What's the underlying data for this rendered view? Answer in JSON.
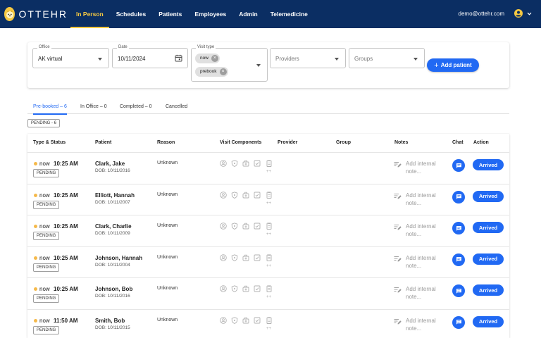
{
  "app": {
    "brand": "OTTEHR"
  },
  "nav": {
    "items": [
      {
        "label": "In Person",
        "active": true
      },
      {
        "label": "Schedules",
        "active": false
      },
      {
        "label": "Patients",
        "active": false
      },
      {
        "label": "Employees",
        "active": false
      },
      {
        "label": "Admin",
        "active": false
      },
      {
        "label": "Telemedicine",
        "active": false
      }
    ]
  },
  "user": {
    "email": "demo@ottehr.com",
    "icon": "account-circle-icon"
  },
  "filters": {
    "office": {
      "label": "Office",
      "value": "AK virtual"
    },
    "date": {
      "label": "Date",
      "value": "10/11/2024"
    },
    "visit_type": {
      "label": "Visit type",
      "chips": [
        "now",
        "prebook"
      ]
    },
    "providers": {
      "placeholder": "Providers"
    },
    "groups": {
      "placeholder": "Groups"
    },
    "add_patient_label": "Add patient"
  },
  "tabs": [
    {
      "label": "Pre-booked – 6",
      "active": true
    },
    {
      "label": "In Office – 0",
      "active": false
    },
    {
      "label": "Completed – 0",
      "active": false
    },
    {
      "label": "Cancelled",
      "active": false
    }
  ],
  "pending_group_label": "PENDING - 6",
  "table": {
    "columns": {
      "type_status": "Type & Status",
      "patient": "Patient",
      "reason": "Reason",
      "visit_components": "Visit Components",
      "provider": "Provider",
      "group": "Group",
      "notes": "Notes",
      "chat": "Chat",
      "action": "Action"
    },
    "visit_component_icons": [
      "user-check-icon",
      "shield-icon",
      "briefcase-icon",
      "checkbox-icon",
      "clipboard-icon"
    ],
    "visit_components_more": "++",
    "notes_placeholder": "Add internal note...",
    "action_label": "Arrived",
    "status_color": "#f5b94a",
    "rows": [
      {
        "type": "now",
        "time": "10:25 AM",
        "status": "PENDING",
        "name": "Clark, Jake",
        "dob": "DOB: 10/11/2016",
        "reason": "Unknown"
      },
      {
        "type": "now",
        "time": "10:25 AM",
        "status": "PENDING",
        "name": "Elliott, Hannah",
        "dob": "DOB: 10/11/2007",
        "reason": "Unknown"
      },
      {
        "type": "now",
        "time": "10:25 AM",
        "status": "PENDING",
        "name": "Clark, Charlie",
        "dob": "DOB: 10/11/2009",
        "reason": "Unknown"
      },
      {
        "type": "now",
        "time": "10:25 AM",
        "status": "PENDING",
        "name": "Johnson, Hannah",
        "dob": "DOB: 10/11/2004",
        "reason": "Unknown"
      },
      {
        "type": "now",
        "time": "10:25 AM",
        "status": "PENDING",
        "name": "Johnson, Bob",
        "dob": "DOB: 10/11/2016",
        "reason": "Unknown"
      },
      {
        "type": "now",
        "time": "11:50 AM",
        "status": "PENDING",
        "name": "Smith, Bob",
        "dob": "DOB: 10/11/2015",
        "reason": "Unknown"
      }
    ]
  },
  "colors": {
    "header_bg": "#0b2e63",
    "accent": "#f5c842",
    "primary": "#2169f3"
  }
}
